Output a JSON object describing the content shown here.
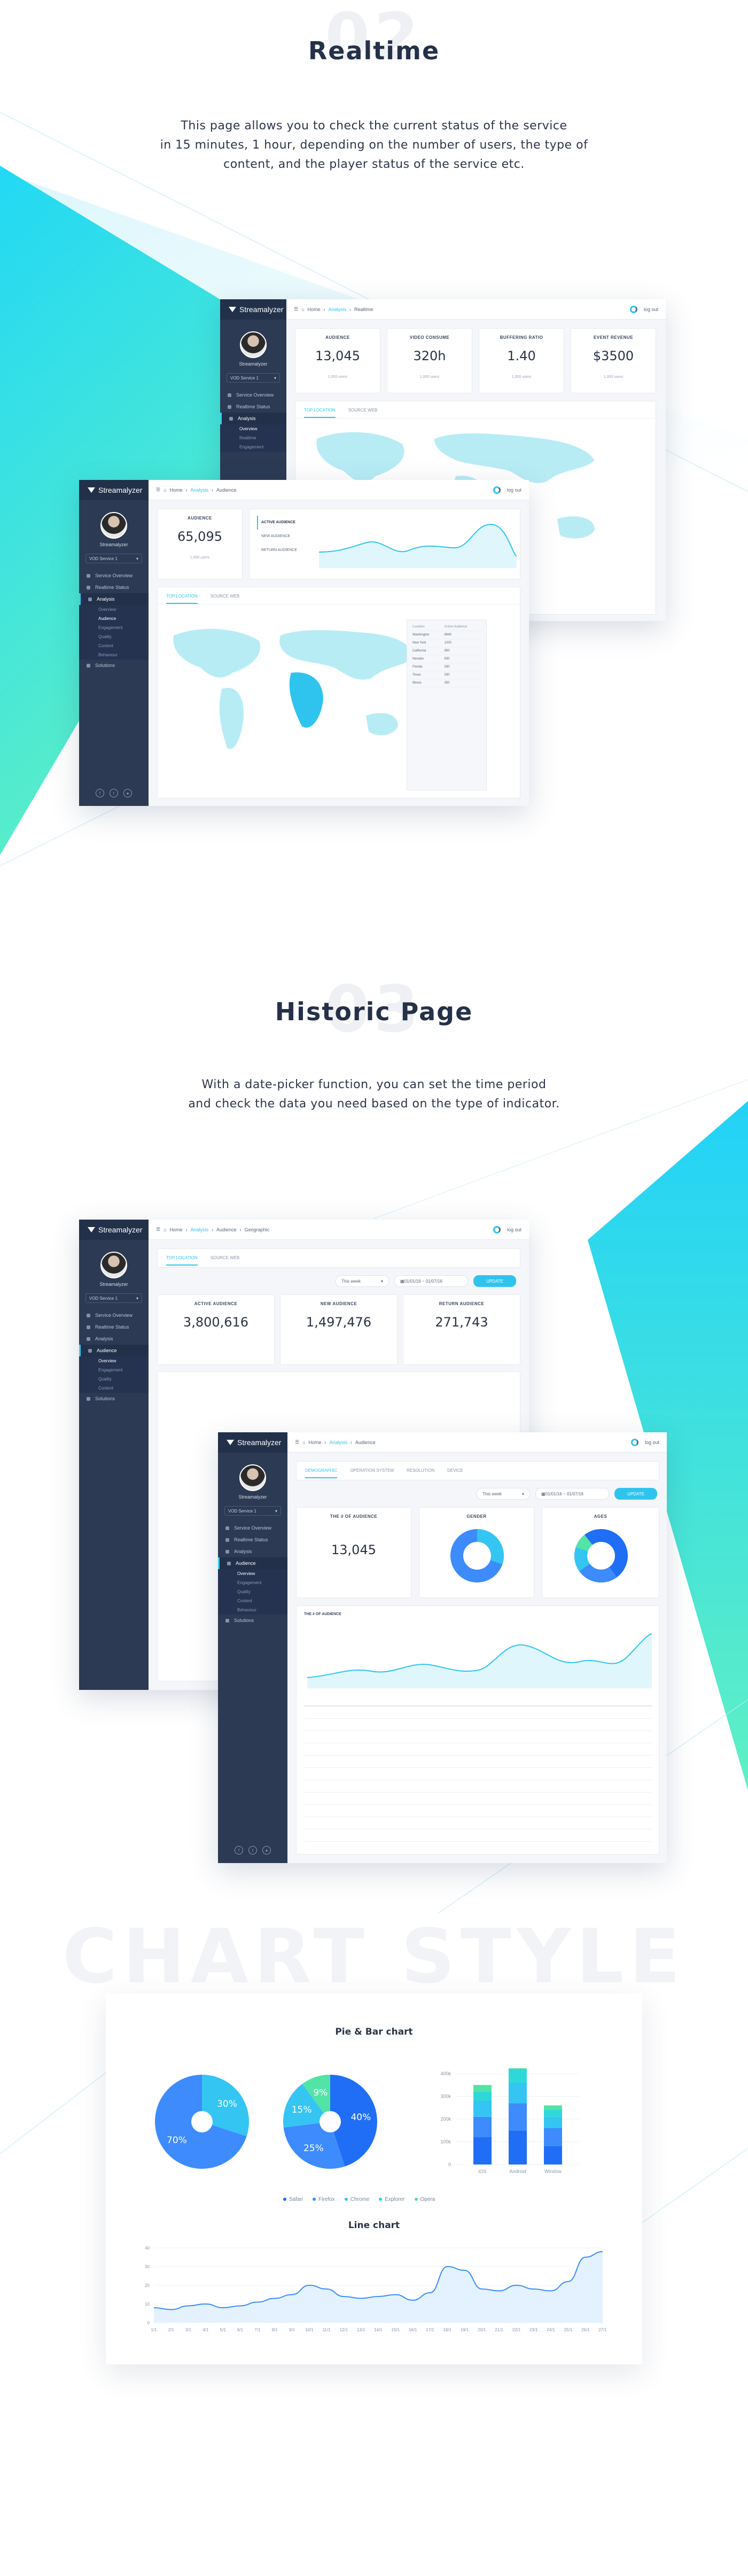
{
  "sections": {
    "realtime": {
      "number": "02",
      "title": "Realtime",
      "desc": [
        "This page allows you to check the current status of the service",
        "in 15 minutes, 1 hour, depending on the number of users, the type of",
        "content, and the player status of the service etc."
      ]
    },
    "historic": {
      "number": "03",
      "title": "Historic Page",
      "desc": [
        "With a date-picker function, you can set the time period",
        "and check the data you need based on the type of indicator."
      ]
    },
    "chartstyle": {
      "watermark": "CHART STYLE",
      "pie_bar_title": "Pie & Bar chart",
      "line_title": "Line chart"
    }
  },
  "app": {
    "brand": "Streamalyzer",
    "user": "Streamalyzer",
    "service_select": "VOD Service 1",
    "logout": "log out",
    "crumbs": [
      "Home",
      "Analysis",
      "Realtime",
      "Audience",
      "Geographic"
    ],
    "nav": [
      "Service Overview",
      "Realtime Status",
      "Analysis",
      "Audience",
      "Overview",
      "Realtime",
      "Engagement",
      "Quality",
      "Content",
      "Behaviour",
      "Solutions"
    ],
    "realtime_cards": [
      {
        "label": "AUDIENCE",
        "value": "13,045",
        "cap": "1,000 users"
      },
      {
        "label": "VIDEO CONSUME",
        "value": "320h",
        "cap": "1,000 users"
      },
      {
        "label": "BUFFERING RATIO",
        "value": "1.40",
        "cap": "1,000 users"
      },
      {
        "label": "EVENT REVENUE",
        "value": "$3500",
        "cap": "1,000 users"
      }
    ],
    "audience_card": {
      "label": "AUDIENCE",
      "value": "65,095",
      "cap": "1,000 users"
    },
    "active_audience_legend": [
      "ACTIVE AUDIENCE",
      "NEW AUDIENCE",
      "RETURN AUDIENCE"
    ],
    "tabs_geo": [
      "TOP LOCATION",
      "SOURCE WEB"
    ],
    "geo_table": {
      "headers": [
        "Location",
        "Active Audience"
      ],
      "rows": [
        [
          "Washington",
          "6840"
        ],
        [
          "New York",
          "1200"
        ],
        [
          "California",
          "950"
        ],
        [
          "Nevada",
          "830"
        ],
        [
          "Florida",
          "330"
        ],
        [
          "Texas",
          "330"
        ],
        [
          "Illinois",
          "350"
        ]
      ]
    },
    "period": "This week",
    "date_range": "01/01/16 ~ 01/07/16",
    "update_btn": "UPDATE",
    "historic_cards": [
      {
        "label": "ACTIVE AUDIENCE",
        "value": "3,800,616"
      },
      {
        "label": "NEW AUDIENCE",
        "value": "1,497,476"
      },
      {
        "label": "RETURN AUDIENCE",
        "value": "271,743"
      }
    ],
    "tabs_hist2": [
      "DEMOGRAPHIC",
      "OPERATION SYSTEM",
      "RESOLUTION",
      "DEVICE"
    ],
    "hist2_cards": [
      {
        "label": "THE # OF AUDIENCE",
        "value": "13,045"
      },
      {
        "label": "GENDER",
        "value": ""
      },
      {
        "label": "AGES",
        "value": ""
      }
    ],
    "hist2_chart_title": "THE # OF AUDIENCE"
  },
  "chart_data": [
    {
      "type": "pie",
      "categories": [
        "",
        ""
      ],
      "values": [
        30,
        70
      ],
      "labels": [
        "30%",
        "70%"
      ],
      "colors": [
        "#34c5f3",
        "#3d8bfd"
      ]
    },
    {
      "type": "pie",
      "categories": [
        "",
        "",
        "",
        ""
      ],
      "values": [
        40,
        25,
        15,
        9
      ],
      "labels": [
        "40%",
        "25%",
        "15%",
        "9%"
      ],
      "colors": [
        "#1f6ef5",
        "#3d8bfd",
        "#34c5f3",
        "#52e3a7"
      ]
    },
    {
      "type": "bar",
      "categories": [
        "iOS",
        "Android",
        "Window"
      ],
      "ylim": [
        0,
        400
      ],
      "yticks": [
        "400k",
        "300k",
        "200k",
        "100k",
        "0"
      ],
      "series": [
        {
          "name": "Safari",
          "values": [
            120,
            150,
            80
          ],
          "color": "#1f6ef5"
        },
        {
          "name": "Firefox",
          "values": [
            90,
            120,
            80
          ],
          "color": "#3d8bfd"
        },
        {
          "name": "Chrome",
          "values": [
            70,
            90,
            50
          ],
          "color": "#34c5f3"
        },
        {
          "name": "Explorer",
          "values": [
            40,
            60,
            30
          ],
          "color": "#2fd8d8"
        },
        {
          "name": "Opera",
          "values": [
            30,
            40,
            20
          ],
          "color": "#52e3a7"
        }
      ]
    },
    {
      "type": "line",
      "ylim": [
        0,
        40
      ],
      "yticks": [
        "40",
        "30",
        "20",
        "10",
        "0"
      ],
      "x": [
        "1/1",
        "2/1",
        "3/1",
        "4/1",
        "5/1",
        "6/1",
        "7/1",
        "8/1",
        "9/1",
        "10/1",
        "11/1",
        "12/1",
        "13/1",
        "14/1",
        "15/1",
        "16/1",
        "17/1",
        "18/1",
        "19/1",
        "20/1",
        "21/1",
        "22/1",
        "23/1",
        "24/1",
        "25/1",
        "26/1",
        "27/1"
      ],
      "values": [
        8,
        7,
        9,
        10,
        8,
        9,
        11,
        13,
        15,
        20,
        18,
        14,
        13,
        14,
        15,
        12,
        16,
        30,
        28,
        18,
        17,
        20,
        18,
        17,
        22,
        35,
        38
      ],
      "color": "#3d8bfd"
    }
  ]
}
